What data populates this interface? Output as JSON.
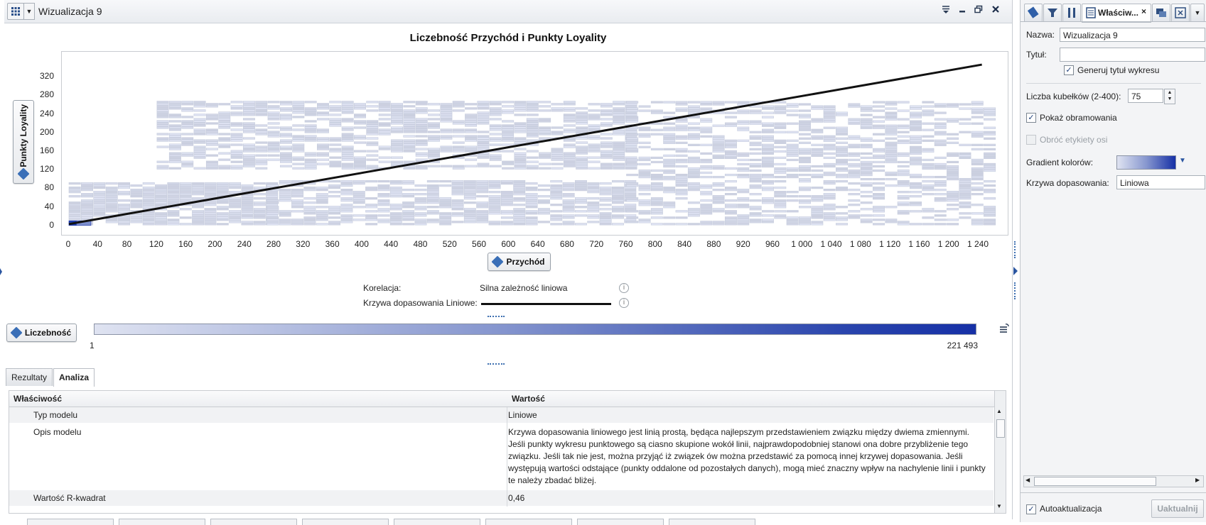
{
  "window": {
    "title": "Wizualizacja 9",
    "controls": [
      "sort-icon",
      "minimize-icon",
      "restore-icon",
      "close-icon"
    ]
  },
  "chart": {
    "title": "Liczebność Przychód i Punkty Loyality",
    "y_axis_button": "Punkty Loyality",
    "x_axis_button": "Przychód"
  },
  "chart_data": {
    "type": "heatmap",
    "title": "Liczebność Przychód i Punkty Loyality",
    "xlabel": "Przychód",
    "ylabel": "Punkty Loyality",
    "x_ticks": [
      "0",
      "40",
      "80",
      "120",
      "160",
      "200",
      "240",
      "280",
      "320",
      "360",
      "400",
      "440",
      "480",
      "520",
      "560",
      "600",
      "640",
      "680",
      "720",
      "760",
      "800",
      "840",
      "880",
      "920",
      "960",
      "1 000",
      "1 040",
      "1 080",
      "1 120",
      "1 160",
      "1 200",
      "1 240"
    ],
    "y_ticks": [
      "0",
      "40",
      "80",
      "120",
      "160",
      "200",
      "240",
      "280",
      "320"
    ],
    "xlim": [
      0,
      1260
    ],
    "ylim": [
      -8,
      340
    ],
    "color_metric": "Liczebność",
    "color_range": [
      "1",
      "221 493"
    ],
    "fit_line": {
      "type": "Liniowe",
      "x": [
        0,
        1260
      ],
      "y": [
        3,
        346
      ]
    },
    "dense_bins": [
      {
        "x": [
          0,
          10
        ],
        "y": [
          0,
          10
        ],
        "level": 1.0
      },
      {
        "x": [
          10,
          30
        ],
        "y": [
          0,
          10
        ],
        "level": 0.55
      }
    ],
    "cluster_regions": [
      {
        "x": [
          0,
          270
        ],
        "y": [
          0,
          90
        ],
        "level": 0.12
      },
      {
        "x": [
          270,
          760
        ],
        "y": [
          0,
          95
        ],
        "level": 0.08
      },
      {
        "x": [
          120,
          760
        ],
        "y": [
          120,
          265
        ],
        "level": 0.07
      },
      {
        "x": [
          760,
          1260
        ],
        "y": [
          0,
          265
        ],
        "level": 0.04
      }
    ]
  },
  "stats": {
    "correlation_label": "Korelacja:",
    "correlation_value": "Silna zależność liniowa",
    "fit_label": "Krzywa dopasowania Liniowe:"
  },
  "legend": {
    "button": "Liczebność",
    "min": "1",
    "max": "221 493",
    "gradient": [
      "#dfe3f1",
      "#8797cf",
      "#2a45ad",
      "#1630a6"
    ]
  },
  "tabs": [
    {
      "label": "Rezultaty",
      "active": false
    },
    {
      "label": "Analiza",
      "active": true
    }
  ],
  "table": {
    "headers": [
      "Właściwość",
      "Wartość"
    ],
    "rows": [
      {
        "property": "Typ modelu",
        "value": "Liniowe"
      },
      {
        "property": "Opis modelu",
        "value_lines": [
          "Krzywa dopasowania liniowego jest linią prostą, będąca najlepszym przedstawieniem związku między dwiema zmiennymi.",
          "Jeśli punkty wykresu punktowego są ciasno skupione wokół linii, najprawdopodobniej stanowi ona dobre przybliżenie tego",
          "związku. Jeśli tak nie jest, można przyjąć iż związek ów można przedstawić za pomocą innej krzywej dopasowania. Jeśli",
          "występują wartości odstające (punkty oddalone od pozostałych danych), mogą mieć znaczny wpływ na nachylenie linii i punkty",
          "te należy zbadać bliżej."
        ]
      },
      {
        "property": "Wartość R-kwadrat",
        "value": "0,46"
      }
    ]
  },
  "side_panel": {
    "active_tab": "Właściw...",
    "name_label": "Nazwa:",
    "name_value": "Wizualizacja 9",
    "title_label": "Tytuł:",
    "title_value": "",
    "gen_title_label": "Generuj tytuł wykresu",
    "gen_title_checked": true,
    "bins_label": "Liczba kubełków (2-400):",
    "bins_value": "75",
    "borders_label": "Pokaż obramowania",
    "borders_checked": true,
    "rotate_label": "Obróć etykiety osi",
    "rotate_checked": false,
    "gradient_label": "Gradient kolorów:",
    "fit_label": "Krzywa dopasowania:",
    "fit_value": "Liniowa",
    "auto_label": "Autoaktualizacja",
    "auto_checked": true,
    "update_button": "Uaktualnij"
  }
}
